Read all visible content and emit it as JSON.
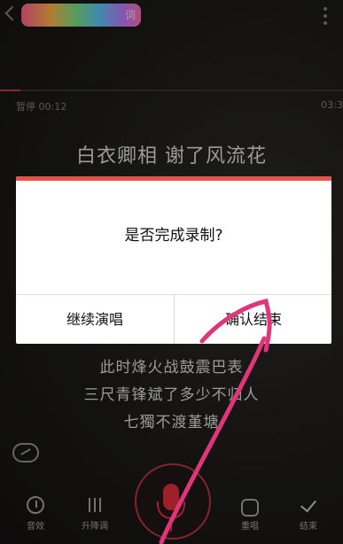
{
  "header": {
    "song_title": "词",
    "time_elapsed": "暂停 00:12",
    "time_total": "03:3",
    "progress": 0.06
  },
  "lyrics": {
    "current": "白衣卿相 谢了风流花",
    "upcoming": [
      "此时烽火战鼓震巴表",
      "三尺青锋斌了多少不归人",
      "七獨不渡堇塘"
    ]
  },
  "dialog": {
    "message": "是否完成录制?",
    "continue_label": "继续演唱",
    "confirm_label": "确认结束"
  },
  "toolbar": {
    "tools": [
      {
        "label": "音效",
        "icon": "gauge-icon"
      },
      {
        "label": "升降调",
        "icon": "slider-icon"
      },
      {
        "label": "重唱",
        "icon": "repeat-icon"
      },
      {
        "label": "结束",
        "icon": "check-icon"
      }
    ]
  },
  "colors": {
    "accent": "#e4544b",
    "mic": "#d62b38",
    "annotation": "#e0357a"
  }
}
